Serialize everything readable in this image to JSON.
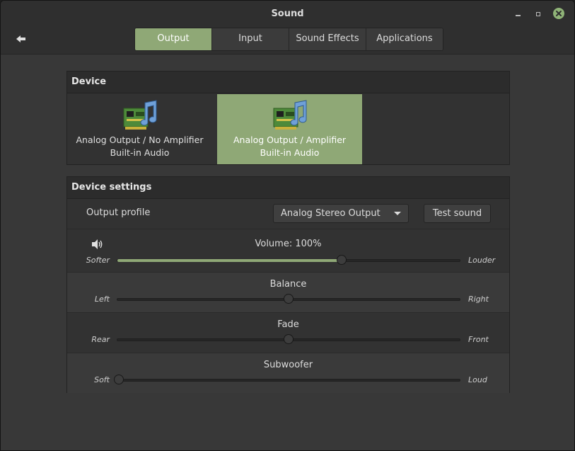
{
  "window": {
    "title": "Sound"
  },
  "tabs": [
    {
      "label": "Output",
      "active": true
    },
    {
      "label": "Input",
      "active": false
    },
    {
      "label": "Sound Effects",
      "active": false
    },
    {
      "label": "Applications",
      "active": false
    }
  ],
  "device": {
    "heading": "Device",
    "items": [
      {
        "line1": "Analog Output / No Amplifier",
        "line2": "Built-in Audio",
        "selected": false,
        "icon": "audio-card-icon"
      },
      {
        "line1": "Analog Output / Amplifier",
        "line2": "Built-in Audio",
        "selected": true,
        "icon": "audio-card-icon"
      }
    ]
  },
  "settings": {
    "heading": "Device settings",
    "output_profile_label": "Output profile",
    "output_profile_value": "Analog Stereo Output",
    "test_sound_label": "Test sound",
    "volume": {
      "title": "Volume: 100%",
      "left": "Softer",
      "right": "Louder",
      "value": 0.655
    },
    "balance": {
      "title": "Balance",
      "left": "Left",
      "right": "Right",
      "value": 0.5
    },
    "fade": {
      "title": "Fade",
      "left": "Rear",
      "right": "Front",
      "value": 0.5
    },
    "subwoofer": {
      "title": "Subwoofer",
      "left": "Soft",
      "right": "Loud",
      "value": 0.0
    }
  },
  "colors": {
    "accent": "#8fa876",
    "background": "#383838"
  }
}
